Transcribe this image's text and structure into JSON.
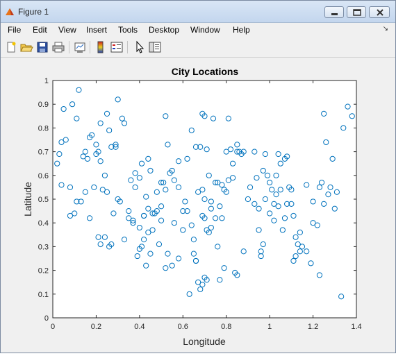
{
  "window": {
    "title": "Figure 1",
    "minimize_label": "minimize",
    "maximize_label": "maximize",
    "close_label": "close"
  },
  "menu": {
    "items": [
      "File",
      "Edit",
      "View",
      "Insert",
      "Tools",
      "Desktop",
      "Window",
      "Help"
    ],
    "dock_arrow": "↘"
  },
  "toolbar": {
    "buttons": [
      "new-figure-icon",
      "open-file-icon",
      "save-icon",
      "print-icon",
      "link-plot-icon",
      "insert-colorbar-icon",
      "insert-legend-icon",
      "edit-plot-arrow-icon",
      "property-inspector-icon"
    ]
  },
  "colors": {
    "marker": "#0072bd",
    "axes_bg": "#ffffff",
    "figure_bg": "#f0f0f0"
  },
  "chart_data": {
    "type": "scatter",
    "title": "City Locations",
    "xlabel": "Longitude",
    "ylabel": "Latitude",
    "xlim": [
      0,
      1.4
    ],
    "ylim": [
      0,
      1
    ],
    "xticks": [
      "0",
      "0.2",
      "0.4",
      "0.6",
      "0.8",
      "1",
      "1.2",
      "1.4"
    ],
    "yticks": [
      "0",
      "0.1",
      "0.2",
      "0.3",
      "0.4",
      "0.5",
      "0.6",
      "0.7",
      "0.8",
      "0.9",
      "1"
    ],
    "grid": false,
    "marker": "circle",
    "x": [
      0.05,
      0.12,
      0.09,
      0.11,
      0.04,
      0.06,
      0.08,
      0.18,
      0.17,
      0.14,
      0.11,
      0.21,
      0.22,
      0.25,
      0.26,
      0.22,
      0.24,
      0.3,
      0.29,
      0.32,
      0.33,
      0.37,
      0.35,
      0.42,
      0.41,
      0.43,
      0.45,
      0.44,
      0.41,
      0.38,
      0.36,
      0.4,
      0.43,
      0.46,
      0.48,
      0.5,
      0.51,
      0.52,
      0.53,
      0.55,
      0.56,
      0.58,
      0.62,
      0.64,
      0.66,
      0.67,
      0.69,
      0.7,
      0.71,
      0.72,
      0.74,
      0.69,
      0.68,
      0.7,
      0.71,
      0.73,
      0.76,
      0.78,
      0.79,
      0.8,
      0.81,
      0.82,
      0.83,
      0.85,
      0.86,
      0.87,
      0.88,
      0.85,
      0.84,
      0.8,
      0.77,
      0.76,
      0.75,
      0.73,
      0.72,
      0.7,
      0.69,
      0.67,
      0.66,
      0.65,
      0.64,
      0.62,
      0.6,
      0.58,
      0.55,
      0.53,
      0.52,
      0.5,
      0.49,
      0.47,
      0.45,
      0.44,
      0.42,
      0.4,
      0.39,
      0.37,
      0.33,
      0.31,
      0.29,
      0.27,
      0.25,
      0.23,
      0.2,
      0.19,
      0.17,
      0.15,
      0.13,
      0.1,
      0.08,
      0.04,
      0.03,
      0.02,
      0.93,
      0.94,
      0.95,
      0.96,
      0.97,
      0.98,
      1.0,
      1.01,
      1.02,
      1.03,
      1.04,
      1.05,
      1.06,
      1.07,
      1.08,
      1.09,
      1.1,
      1.11,
      1.12,
      1.13,
      1.14,
      1.15,
      1.17,
      1.19,
      1.2,
      1.22,
      1.23,
      1.24,
      1.25,
      1.26,
      1.27,
      1.28,
      1.29,
      1.3,
      1.31,
      1.33,
      1.34,
      1.36,
      1.38,
      1.25,
      1.23,
      1.2,
      1.17,
      1.14,
      1.12,
      1.11,
      1.1,
      1.08,
      1.07,
      1.05,
      1.04,
      1.03,
      1.02,
      1.0,
      0.99,
      0.98,
      0.97,
      0.96,
      0.95,
      0.93,
      0.91,
      0.9,
      0.88,
      0.85,
      0.83,
      0.81,
      0.79,
      0.78,
      0.77,
      0.75,
      0.73,
      0.71,
      0.7,
      0.69,
      0.68,
      0.66,
      0.65,
      0.63,
      0.61,
      0.6,
      0.58,
      0.56,
      0.54,
      0.52,
      0.5,
      0.48,
      0.46,
      0.44,
      0.42,
      0.4,
      0.38,
      0.35,
      0.3,
      0.28,
      0.27,
      0.26,
      0.24,
      0.22,
      0.21,
      0.2,
      0.16,
      0.15
    ],
    "y": [
      0.88,
      0.96,
      0.9,
      0.84,
      0.74,
      0.75,
      0.55,
      0.77,
      0.76,
      0.68,
      0.49,
      0.7,
      0.66,
      0.86,
      0.79,
      0.82,
      0.6,
      0.92,
      0.73,
      0.84,
      0.82,
      0.4,
      0.45,
      0.43,
      0.3,
      0.22,
      0.62,
      0.67,
      0.65,
      0.61,
      0.58,
      0.38,
      0.51,
      0.37,
      0.45,
      0.47,
      0.57,
      0.85,
      0.73,
      0.62,
      0.58,
      0.66,
      0.67,
      0.79,
      0.72,
      0.53,
      0.86,
      0.85,
      0.71,
      0.6,
      0.84,
      0.54,
      0.72,
      0.5,
      0.16,
      0.46,
      0.57,
      0.56,
      0.21,
      0.7,
      0.84,
      0.71,
      0.65,
      0.73,
      0.7,
      0.69,
      0.28,
      0.18,
      0.19,
      0.53,
      0.16,
      0.3,
      0.42,
      0.38,
      0.36,
      0.17,
      0.14,
      0.15,
      0.24,
      0.33,
      0.39,
      0.45,
      0.37,
      0.25,
      0.22,
      0.27,
      0.21,
      0.41,
      0.31,
      0.44,
      0.27,
      0.36,
      0.33,
      0.29,
      0.26,
      0.41,
      0.33,
      0.49,
      0.72,
      0.72,
      0.53,
      0.54,
      0.69,
      0.55,
      0.42,
      0.53,
      0.49,
      0.44,
      0.43,
      0.56,
      0.69,
      0.65,
      0.7,
      0.59,
      0.37,
      0.26,
      0.31,
      0.5,
      0.57,
      0.54,
      0.48,
      0.6,
      0.69,
      0.65,
      0.37,
      0.67,
      0.68,
      0.55,
      0.48,
      0.43,
      0.34,
      0.31,
      0.28,
      0.3,
      0.28,
      0.23,
      0.49,
      0.39,
      0.55,
      0.57,
      0.48,
      0.74,
      0.52,
      0.55,
      0.67,
      0.46,
      0.53,
      0.09,
      0.8,
      0.89,
      0.85,
      0.86,
      0.18,
      0.4,
      0.56,
      0.36,
      0.26,
      0.24,
      0.54,
      0.48,
      0.42,
      0.54,
      0.47,
      0.52,
      0.41,
      0.44,
      0.6,
      0.69,
      0.62,
      0.28,
      0.46,
      0.48,
      0.55,
      0.5,
      0.7,
      0.7,
      0.59,
      0.58,
      0.54,
      0.42,
      0.47,
      0.57,
      0.49,
      0.37,
      0.42,
      0.43,
      0.12,
      0.24,
      0.27,
      0.1,
      0.49,
      0.45,
      0.55,
      0.4,
      0.61,
      0.54,
      0.57,
      0.53,
      0.44,
      0.46,
      0.43,
      0.59,
      0.55,
      0.42,
      0.5,
      0.44,
      0.31,
      0.3,
      0.34,
      0.31,
      0.34,
      0.73,
      0.67,
      0.7,
      0.71,
      0.44,
      0.79,
      0.77
    ]
  }
}
